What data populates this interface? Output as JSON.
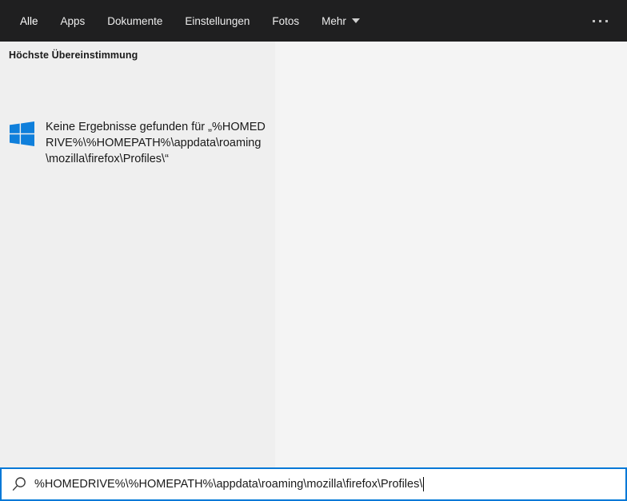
{
  "colors": {
    "topbar_bg": "#1f1f20",
    "accent_blue": "#0078d7",
    "windows_logo_blue": "#0f7fdb",
    "left_panel_bg": "#efefef",
    "right_panel_bg": "#f4f4f4"
  },
  "topbar": {
    "tabs": [
      "Alle",
      "Apps",
      "Dokumente",
      "Einstellungen",
      "Fotos"
    ],
    "more_label": "Mehr",
    "more_options_icon": "ellipsis"
  },
  "results": {
    "section_heading": "Höchste Übereinstimmung",
    "no_results_line": "Keine Ergebnisse gefunden für",
    "query_quoted": "„%HOMEDRIVE%\\%HOMEPATH%\\appdata\\roaming\\mozilla\\firefox\\Profiles\\“",
    "result_icon": "windows-logo"
  },
  "search": {
    "value": "%HOMEDRIVE%\\%HOMEPATH%\\appdata\\roaming\\mozilla\\firefox\\Profiles\\",
    "icon": "search-magnifier"
  }
}
